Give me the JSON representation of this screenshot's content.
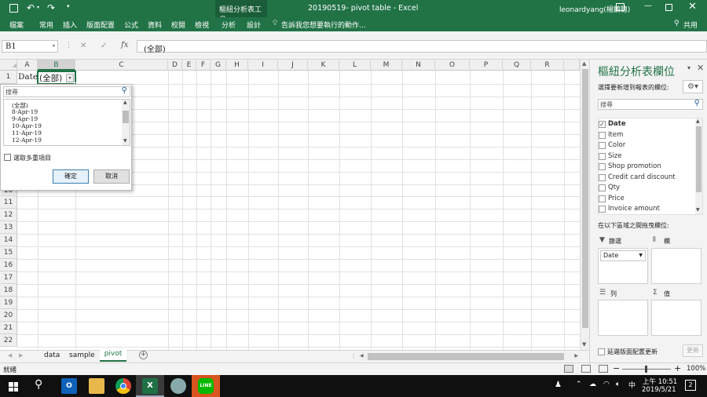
{
  "window": {
    "context_tool_title": "樞紐分析表工具",
    "title": "20190519- pivot table - Excel",
    "user": "leonardyang(楊鎮聰)",
    "share": "共用"
  },
  "ribbon": {
    "tabs": [
      "檔案",
      "常用",
      "插入",
      "版面配置",
      "公式",
      "資料",
      "校閱",
      "檢視",
      "分析",
      "設計"
    ],
    "tellme": "告訴我您想要執行的動作..."
  },
  "formula_bar": {
    "name_box": "B1",
    "fx": "fx",
    "value": "(全部)"
  },
  "grid": {
    "columns": [
      "A",
      "B",
      "C",
      "D",
      "E",
      "F",
      "G",
      "H",
      "I",
      "J",
      "K",
      "L",
      "M",
      "N",
      "O",
      "P",
      "Q",
      "R"
    ],
    "rows": [
      "1",
      "10",
      "11",
      "12",
      "13",
      "14",
      "15",
      "16",
      "17",
      "18",
      "19",
      "20",
      "21",
      "22"
    ],
    "a1": "Date",
    "b1": "(全部)"
  },
  "filter_dropdown": {
    "search_placeholder": "搜尋",
    "items": [
      "(全部)",
      "8-Apr-19",
      "9-Apr-19",
      "10-Apr-19",
      "11-Apr-19",
      "12-Apr-19"
    ],
    "multi_select": "選取多重項目",
    "ok": "確定",
    "cancel": "取消"
  },
  "sheets": {
    "tabs": [
      "data",
      "sample",
      "pivot"
    ],
    "active": "pivot"
  },
  "status": {
    "ready": "就緒",
    "zoom": "100%"
  },
  "pane": {
    "title": "樞紐分析表欄位",
    "subtitle": "選擇要新增到報表的欄位:",
    "search_placeholder": "搜尋",
    "fields": [
      {
        "label": "Date",
        "checked": true
      },
      {
        "label": "Item",
        "checked": false
      },
      {
        "label": "Color",
        "checked": false
      },
      {
        "label": "Size",
        "checked": false
      },
      {
        "label": "Shop promotion",
        "checked": false
      },
      {
        "label": "Credit card discount",
        "checked": false
      },
      {
        "label": "Qty",
        "checked": false
      },
      {
        "label": "Price",
        "checked": false
      },
      {
        "label": "Invoice amount",
        "checked": false
      }
    ],
    "areas_label": "在以下區域之間拖曳欄位:",
    "filters": "篩選",
    "filters_item": "Date",
    "columns": "欄",
    "rows": "列",
    "values": "值",
    "defer": "延遲版面配置更新",
    "update": "更新"
  },
  "taskbar": {
    "time": "上午 10:51",
    "date": "2019/5/21",
    "notif": "2"
  },
  "colors": {
    "excel_green": "#217346",
    "selected": "#217346"
  }
}
